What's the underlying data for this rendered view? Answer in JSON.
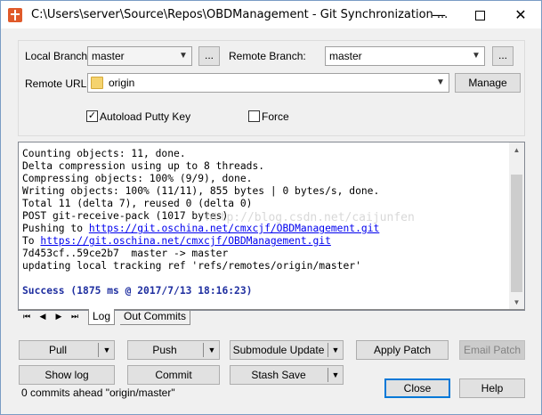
{
  "window": {
    "title": "C:\\Users\\server\\Source\\Repos\\OBDManagement - Git Synchronization ...",
    "minimize_glyph": "—",
    "close_glyph": "✕"
  },
  "branches": {
    "local_label": "Local Branch:",
    "local_value": "master",
    "remote_label": "Remote Branch:",
    "remote_value": "master",
    "dots": "..."
  },
  "remote": {
    "url_label": "Remote URL:",
    "url_value": "origin",
    "manage_label": "Manage"
  },
  "options": {
    "autoload_label": "Autoload Putty Key",
    "autoload_checked": true,
    "force_label": "Force",
    "force_checked": false
  },
  "console": {
    "lines": [
      "Counting objects: 11, done.",
      "Delta compression using up to 8 threads.",
      "Compressing objects: 100% (9/9), done.",
      "Writing objects: 100% (11/11), 855 bytes | 0 bytes/s, done.",
      "Total 11 (delta 7), reused 0 (delta 0)",
      "POST git-receive-pack (1017 bytes)"
    ],
    "pushing_prefix": "Pushing to ",
    "pushing_url": "https://git.oschina.net/cmxcjf/OBDManagement.git",
    "to_prefix": "To ",
    "to_url": "https://git.oschina.net/cmxcjf/OBDManagement.git",
    "line_ref": "7d453cf..59ce2b7  master -> master",
    "line_update": "updating local tracking ref 'refs/remotes/origin/master'",
    "success": "Success (1875 ms @ 2017/7/13 18:16:23)",
    "watermark": "http://blog.csdn.net/caijunfen"
  },
  "tabs": {
    "nav": [
      "⏮",
      "◀",
      "▶",
      "⏭"
    ],
    "log": "Log",
    "out_commits": "Out Commits"
  },
  "buttons": {
    "pull": "Pull",
    "push": "Push",
    "submodule_update": "Submodule Update",
    "apply_patch": "Apply Patch",
    "email_patch": "Email Patch",
    "show_log": "Show log",
    "commit": "Commit",
    "stash_save": "Stash Save",
    "close": "Close",
    "help": "Help"
  },
  "status": "0 commits ahead \"origin/master\""
}
